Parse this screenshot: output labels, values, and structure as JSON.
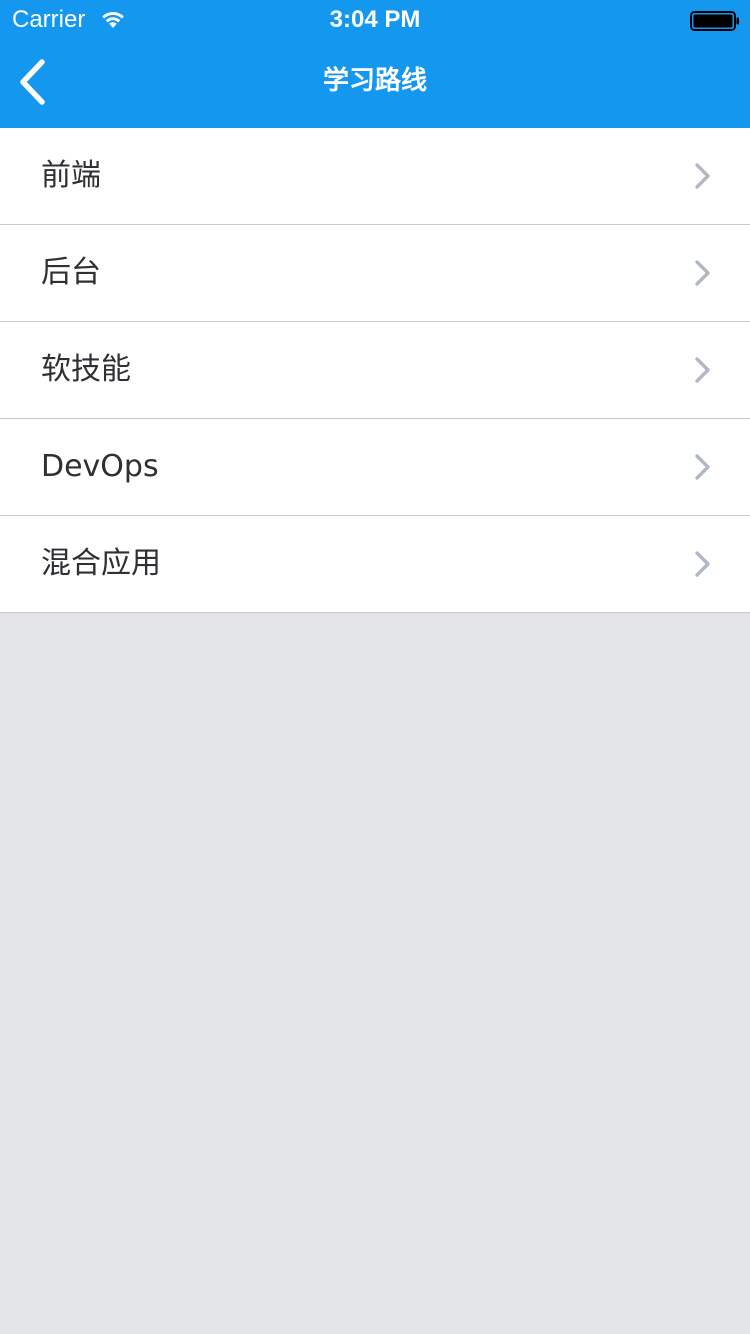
{
  "status_bar": {
    "carrier": "Carrier",
    "time": "3:04 PM",
    "wifi_icon": "wifi-icon",
    "battery_icon": "battery-icon"
  },
  "nav": {
    "title": "学习路线",
    "back_icon": "chevron-left-icon"
  },
  "list": {
    "items": [
      {
        "label": "前端"
      },
      {
        "label": "后台"
      },
      {
        "label": "软技能"
      },
      {
        "label": "DevOps"
      },
      {
        "label": "混合应用"
      }
    ],
    "chevron_icon": "chevron-right-icon"
  },
  "colors": {
    "nav_background": "#1497ef",
    "page_background": "#e3e4e8",
    "row_background": "#ffffff",
    "chevron": "#b0b8c4"
  }
}
